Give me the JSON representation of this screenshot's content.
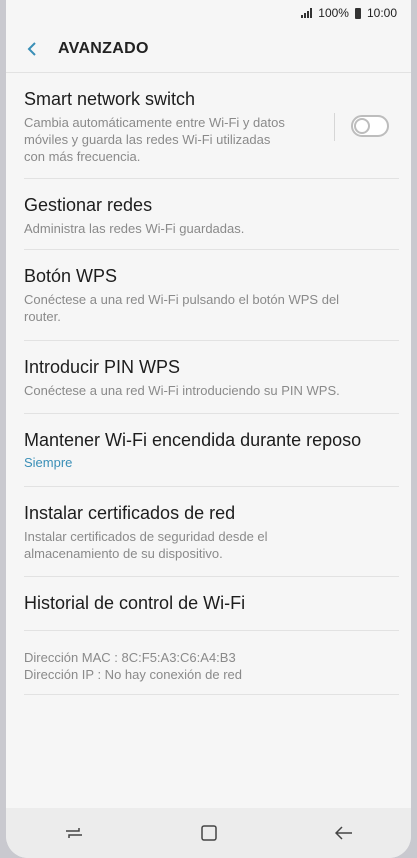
{
  "status": {
    "battery": "100%",
    "time": "10:00"
  },
  "header": {
    "title": "AVANZADO"
  },
  "settings": {
    "smart_switch": {
      "title": "Smart network switch",
      "desc1": "Cambia automáticamente entre Wi-Fi y datos",
      "desc2": "móviles y guarda las redes Wi-Fi utilizadas",
      "desc3": "con más frecuencia.",
      "enabled": false
    },
    "manage_networks": {
      "title": "Gestionar redes",
      "desc": "Administra las redes Wi-Fi guardadas."
    },
    "wps_button": {
      "title": "Botón WPS",
      "desc1": "Conéctese a una red Wi-Fi pulsando el botón WPS del",
      "desc2": "router."
    },
    "wps_pin": {
      "title": "Introducir PIN WPS",
      "desc": "Conéctese a una red Wi-Fi introduciendo su PIN WPS."
    },
    "keep_wifi": {
      "title": "Mantener Wi-Fi encendida durante reposo",
      "value": "Siempre"
    },
    "install_certs": {
      "title": "Instalar certificados de red",
      "desc1": "Instalar certificados de seguridad desde el",
      "desc2": "almacenamiento de su dispositivo."
    },
    "wifi_history": {
      "title": "Historial de control de Wi-Fi"
    },
    "network_info": {
      "mac": "Dirección MAC : 8C:F5:A3:C6:A4:B3",
      "ip": "Dirección IP : No hay conexión de red"
    }
  },
  "colors": {
    "accent": "#3a8fb7",
    "background": "#f6f6f6"
  },
  "icons": {
    "back": "chevron-left-icon",
    "recent": "recent-apps-icon",
    "home": "home-icon",
    "nav_back": "back-arrow-icon"
  }
}
